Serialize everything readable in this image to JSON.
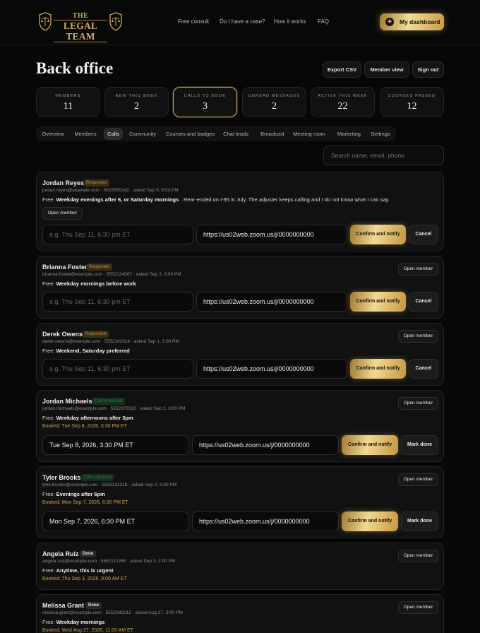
{
  "brand": {
    "line1": "THE",
    "line2": "LEGAL TEAM",
    "accent": "#d3ad5b"
  },
  "nav": {
    "items": [
      "Free consult",
      "Do I have a case?",
      "How it works",
      "FAQ"
    ],
    "dashboard_label": "My dashboard",
    "dashboard_icon": "plus-icon"
  },
  "page": {
    "title": "Back office",
    "actions": [
      "Export CSV",
      "Member view",
      "Sign out"
    ]
  },
  "stats": [
    {
      "label": "MEMBERS",
      "value": "11"
    },
    {
      "label": "NEW THIS WEEK",
      "value": "2"
    },
    {
      "label": "CALLS TO BOOK",
      "value": "3"
    },
    {
      "label": "UNREAD MESSAGES",
      "value": "2"
    },
    {
      "label": "ACTIVE THIS WEEK",
      "value": "22"
    },
    {
      "label": "COURSES PASSED",
      "value": "12"
    }
  ],
  "tabs": [
    "Overview",
    "Members",
    "Calls",
    "Community",
    "Courses and badges",
    "Chat leads",
    "Broadcast",
    "Meeting room",
    "Marketing",
    "Settings"
  ],
  "active_tab": "Calls",
  "search": {
    "placeholder": "Search name, email, phone"
  },
  "labels": {
    "open_member": "Open member",
    "confirm": "Confirm and notify",
    "cancel": "Cancel",
    "mark_done": "Mark done",
    "time_placeholder": "e.g. Thu Sep 11, 6:30 pm ET"
  },
  "calls": [
    {
      "name": "Jordan Reyes",
      "status": "Requested",
      "meta": "jordan.reyes@example.com · 5615550142 · asked Sep 5, 6:53 PM",
      "free_prefix": "Free:",
      "free_time": "Weekday evenings after 6, or Saturday mornings",
      "note": " · Rear-ended on I-95 in July. The adjuster keeps calling and I do not know what I can say.",
      "time_value": "",
      "zoom": "https://us02web.zoom.us/j/0000000000"
    },
    {
      "name": "Brianna Foster",
      "status": "Requested",
      "meta": "brianna.foster@example.com · 5552124967 · asked Sep 3, 3:00 PM",
      "free_prefix": "Free:",
      "free_time": "Weekday mornings before work",
      "time_value": "",
      "zoom": "https://us02web.zoom.us/j/0000000000"
    },
    {
      "name": "Derek Owens",
      "status": "Requested",
      "meta": "derek.owens@example.com · 5552102914 · asked Sep 1, 3:00 PM",
      "free_prefix": "Free:",
      "free_time": "Weekend, Saturday preferred",
      "time_value": "",
      "zoom": "https://us02web.zoom.us/j/0000000000"
    },
    {
      "name": "Jordan Michaels",
      "status": "Call scheduled",
      "meta": "jordan.michaels@example.com · 5552073510 · asked Sep 2, 3:00 PM",
      "free_prefix": "Free:",
      "free_time": "Weekday afternoons after 3pm",
      "booked": "Booked: Tue Sep 8, 2026, 3:30 PM ET",
      "time_value": "Tue Sep 8, 2026, 3:30 PM ET",
      "zoom": "https://us02web.zoom.us/j/0000000000"
    },
    {
      "name": "Tyler Brooks",
      "status": "Call scheduled",
      "meta": "tyler.brooks@example.com · 5552132318 · asked Sep 2, 3:00 PM",
      "free_prefix": "Free:",
      "free_time": "Evenings after 6pm",
      "booked": "Booked: Mon Sep 7, 2026, 6:30 PM ET",
      "time_value": "Mon Sep 7, 2026, 6:30 PM ET",
      "zoom": "https://us02web.zoom.us/j/0000000000"
    },
    {
      "name": "Angela Ruiz",
      "status": "Done",
      "meta": "angela.ruiz@example.com · 5552110265 · asked Sep 3, 3:00 PM",
      "free_prefix": "Free:",
      "free_time": "Anytime, this is urgent",
      "booked": "Booked: Thu Sep 3, 2026, 9:00 AM ET"
    },
    {
      "name": "Melissa Grant",
      "status": "Done",
      "meta": "melissa.grant@example.com · 5552088212 · asked Aug 27, 3:00 PM",
      "free_prefix": "Free:",
      "free_time": "Weekday mornings",
      "booked": "Booked: Wed Aug 27, 2026, 11:00 AM ET"
    }
  ]
}
